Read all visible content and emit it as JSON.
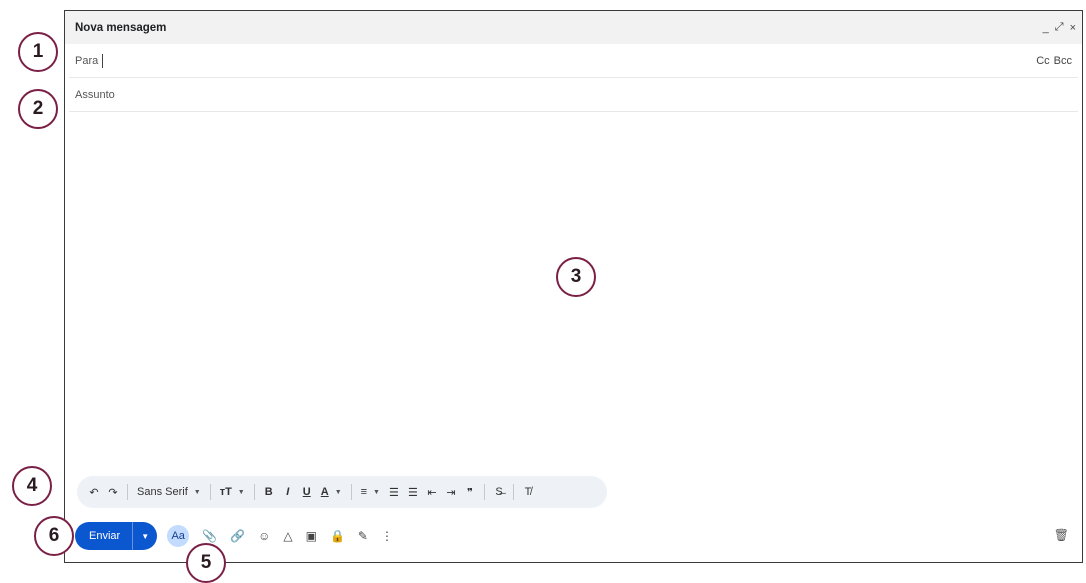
{
  "window": {
    "title": "Nova mensagem",
    "controls": [
      "_",
      "⤢",
      "×"
    ]
  },
  "to_field": {
    "label": "Para",
    "cc": "Cc",
    "bcc": "Bcc"
  },
  "subject_field": {
    "placeholder": "Assunto"
  },
  "format_bar": {
    "undo": "↶",
    "redo": "↷",
    "font": "Sans Serif",
    "font_dropdown": "▼",
    "size": "тT",
    "size_dropdown": "▼",
    "bold": "B",
    "italic": "I",
    "underline": "U",
    "text_color": "A",
    "color_dropdown": "▼",
    "align": "≡",
    "align_dropdown": "▼",
    "numbered_list": "☰",
    "bulleted_list": "☰",
    "indent_less": "⇤",
    "indent_more": "⇥",
    "quote": "❞",
    "strikethrough": "S̶",
    "remove_format": "T̸"
  },
  "bottom_bar": {
    "send_label": "Enviar",
    "send_dropdown": "▼",
    "formatting": "Aa",
    "attach": "📎",
    "link": "🔗",
    "emoji": "☺",
    "drive": "△",
    "photo": "▣",
    "confidential": "🔒",
    "signature": "✎",
    "more": "⋮",
    "trash": "🗑"
  },
  "callouts": [
    "1",
    "2",
    "3",
    "4",
    "5",
    "6"
  ]
}
